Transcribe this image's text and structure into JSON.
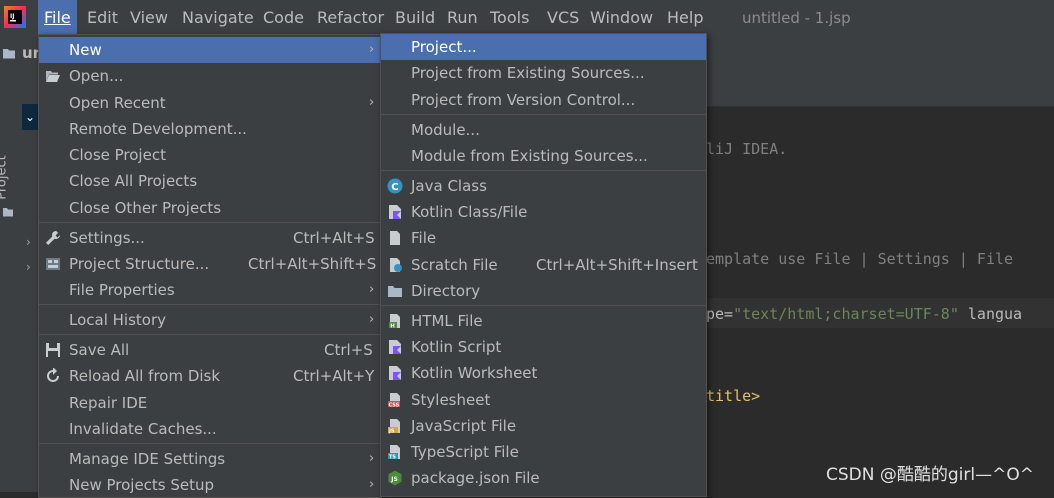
{
  "menubar": {
    "items": [
      "File",
      "Edit",
      "View",
      "Navigate",
      "Code",
      "Refactor",
      "Build",
      "Run",
      "Tools",
      "VCS",
      "Window",
      "Help"
    ],
    "window_title": "untitled - 1.jsp"
  },
  "toolbar": {
    "project_label": "un"
  },
  "side_panel": {
    "label": "Project"
  },
  "file_menu": {
    "items": [
      {
        "label": "New",
        "submenu": true
      },
      {
        "label": "Open...",
        "submenu": false
      },
      {
        "label": "Open Recent",
        "submenu": true
      },
      {
        "label": "Remote Development...",
        "submenu": false
      },
      {
        "label": "Close Project",
        "submenu": false
      },
      {
        "label": "Close All Projects",
        "submenu": false
      },
      {
        "label": "Close Other Projects",
        "submenu": false
      },
      {
        "label": "Settings...",
        "shortcut": "Ctrl+Alt+S"
      },
      {
        "label": "Project Structure...",
        "shortcut": "Ctrl+Alt+Shift+S"
      },
      {
        "label": "File Properties",
        "submenu": true
      },
      {
        "label": "Local History",
        "submenu": true
      },
      {
        "label": "Save All",
        "shortcut": "Ctrl+S"
      },
      {
        "label": "Reload All from Disk",
        "shortcut": "Ctrl+Alt+Y"
      },
      {
        "label": "Repair IDE"
      },
      {
        "label": "Invalidate Caches..."
      },
      {
        "label": "Manage IDE Settings",
        "submenu": true
      },
      {
        "label": "New Projects Setup",
        "submenu": true
      }
    ]
  },
  "new_menu": {
    "items": [
      {
        "label": "Project..."
      },
      {
        "label": "Project from Existing Sources..."
      },
      {
        "label": "Project from Version Control..."
      },
      {
        "label": "Module..."
      },
      {
        "label": "Module from Existing Sources..."
      },
      {
        "label": "Java Class",
        "icon": "java-class-icon"
      },
      {
        "label": "Kotlin Class/File",
        "icon": "kotlin-class-icon"
      },
      {
        "label": "File",
        "icon": "file-icon"
      },
      {
        "label": "Scratch File",
        "icon": "scratch-file-icon",
        "shortcut": "Ctrl+Alt+Shift+Insert"
      },
      {
        "label": "Directory",
        "icon": "folder-icon"
      },
      {
        "label": "HTML File",
        "icon": "html-file-icon"
      },
      {
        "label": "Kotlin Script",
        "icon": "kotlin-script-icon"
      },
      {
        "label": "Kotlin Worksheet",
        "icon": "kotlin-worksheet-icon"
      },
      {
        "label": "Stylesheet",
        "icon": "stylesheet-icon"
      },
      {
        "label": "JavaScript File",
        "icon": "javascript-file-icon"
      },
      {
        "label": "TypeScript File",
        "icon": "typescript-file-icon"
      },
      {
        "label": "package.json File",
        "icon": "nodejs-icon"
      }
    ]
  },
  "editor": {
    "line1": "liJ IDEA.",
    "line2": "emplate use File | Settings | File",
    "line3_pre": "pe=",
    "line3_str": "\"text/html;charset=UTF-8\"",
    "line3_post": " langua",
    "line4": "title>"
  },
  "watermark": "CSDN @酷酷的girl—^O^"
}
